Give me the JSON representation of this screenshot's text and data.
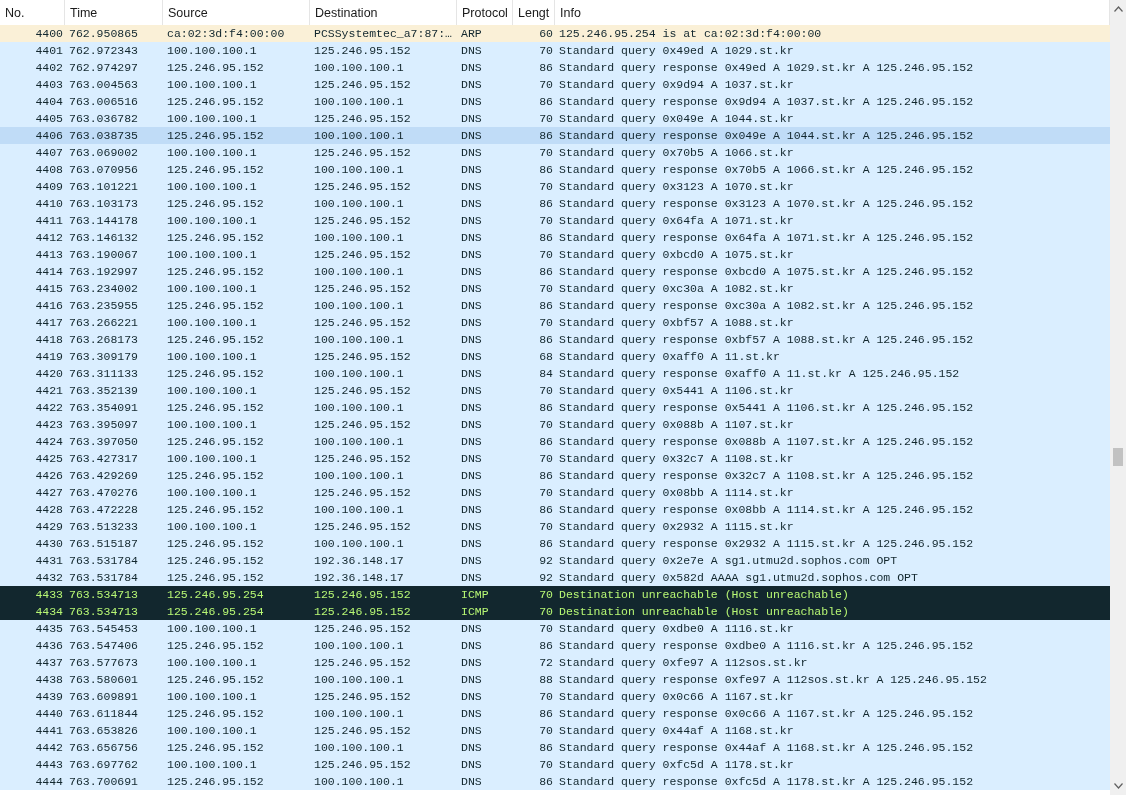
{
  "table": {
    "columns": [
      "No.",
      "Time",
      "Source",
      "Destination",
      "Protocol",
      "Lengt",
      "Info"
    ],
    "rows": [
      {
        "kind": "arp",
        "selected": false,
        "cells": [
          "4400",
          "762.950865",
          "ca:02:3d:f4:00:00",
          "PCSSystemtec_a7:87:…",
          "ARP",
          "60",
          "125.246.95.254 is at ca:02:3d:f4:00:00"
        ]
      },
      {
        "kind": "dns",
        "selected": false,
        "cells": [
          "4401",
          "762.972343",
          "100.100.100.1",
          "125.246.95.152",
          "DNS",
          "70",
          "Standard query 0x49ed A 1029.st.kr"
        ]
      },
      {
        "kind": "dns",
        "selected": false,
        "cells": [
          "4402",
          "762.974297",
          "125.246.95.152",
          "100.100.100.1",
          "DNS",
          "86",
          "Standard query response 0x49ed A 1029.st.kr A 125.246.95.152"
        ]
      },
      {
        "kind": "dns",
        "selected": false,
        "cells": [
          "4403",
          "763.004563",
          "100.100.100.1",
          "125.246.95.152",
          "DNS",
          "70",
          "Standard query 0x9d94 A 1037.st.kr"
        ]
      },
      {
        "kind": "dns",
        "selected": false,
        "cells": [
          "4404",
          "763.006516",
          "125.246.95.152",
          "100.100.100.1",
          "DNS",
          "86",
          "Standard query response 0x9d94 A 1037.st.kr A 125.246.95.152"
        ]
      },
      {
        "kind": "dns",
        "selected": false,
        "cells": [
          "4405",
          "763.036782",
          "100.100.100.1",
          "125.246.95.152",
          "DNS",
          "70",
          "Standard query 0x049e A 1044.st.kr"
        ]
      },
      {
        "kind": "dns",
        "selected": true,
        "cells": [
          "4406",
          "763.038735",
          "125.246.95.152",
          "100.100.100.1",
          "DNS",
          "86",
          "Standard query response 0x049e A 1044.st.kr A 125.246.95.152"
        ]
      },
      {
        "kind": "dns",
        "selected": false,
        "cells": [
          "4407",
          "763.069002",
          "100.100.100.1",
          "125.246.95.152",
          "DNS",
          "70",
          "Standard query 0x70b5 A 1066.st.kr"
        ]
      },
      {
        "kind": "dns",
        "selected": false,
        "cells": [
          "4408",
          "763.070956",
          "125.246.95.152",
          "100.100.100.1",
          "DNS",
          "86",
          "Standard query response 0x70b5 A 1066.st.kr A 125.246.95.152"
        ]
      },
      {
        "kind": "dns",
        "selected": false,
        "cells": [
          "4409",
          "763.101221",
          "100.100.100.1",
          "125.246.95.152",
          "DNS",
          "70",
          "Standard query 0x3123 A 1070.st.kr"
        ]
      },
      {
        "kind": "dns",
        "selected": false,
        "cells": [
          "4410",
          "763.103173",
          "125.246.95.152",
          "100.100.100.1",
          "DNS",
          "86",
          "Standard query response 0x3123 A 1070.st.kr A 125.246.95.152"
        ]
      },
      {
        "kind": "dns",
        "selected": false,
        "cells": [
          "4411",
          "763.144178",
          "100.100.100.1",
          "125.246.95.152",
          "DNS",
          "70",
          "Standard query 0x64fa A 1071.st.kr"
        ]
      },
      {
        "kind": "dns",
        "selected": false,
        "cells": [
          "4412",
          "763.146132",
          "125.246.95.152",
          "100.100.100.1",
          "DNS",
          "86",
          "Standard query response 0x64fa A 1071.st.kr A 125.246.95.152"
        ]
      },
      {
        "kind": "dns",
        "selected": false,
        "cells": [
          "4413",
          "763.190067",
          "100.100.100.1",
          "125.246.95.152",
          "DNS",
          "70",
          "Standard query 0xbcd0 A 1075.st.kr"
        ]
      },
      {
        "kind": "dns",
        "selected": false,
        "cells": [
          "4414",
          "763.192997",
          "125.246.95.152",
          "100.100.100.1",
          "DNS",
          "86",
          "Standard query response 0xbcd0 A 1075.st.kr A 125.246.95.152"
        ]
      },
      {
        "kind": "dns",
        "selected": false,
        "cells": [
          "4415",
          "763.234002",
          "100.100.100.1",
          "125.246.95.152",
          "DNS",
          "70",
          "Standard query 0xc30a A 1082.st.kr"
        ]
      },
      {
        "kind": "dns",
        "selected": false,
        "cells": [
          "4416",
          "763.235955",
          "125.246.95.152",
          "100.100.100.1",
          "DNS",
          "86",
          "Standard query response 0xc30a A 1082.st.kr A 125.246.95.152"
        ]
      },
      {
        "kind": "dns",
        "selected": false,
        "cells": [
          "4417",
          "763.266221",
          "100.100.100.1",
          "125.246.95.152",
          "DNS",
          "70",
          "Standard query 0xbf57 A 1088.st.kr"
        ]
      },
      {
        "kind": "dns",
        "selected": false,
        "cells": [
          "4418",
          "763.268173",
          "125.246.95.152",
          "100.100.100.1",
          "DNS",
          "86",
          "Standard query response 0xbf57 A 1088.st.kr A 125.246.95.152"
        ]
      },
      {
        "kind": "dns",
        "selected": false,
        "cells": [
          "4419",
          "763.309179",
          "100.100.100.1",
          "125.246.95.152",
          "DNS",
          "68",
          "Standard query 0xaff0 A 11.st.kr"
        ]
      },
      {
        "kind": "dns",
        "selected": false,
        "cells": [
          "4420",
          "763.311133",
          "125.246.95.152",
          "100.100.100.1",
          "DNS",
          "84",
          "Standard query response 0xaff0 A 11.st.kr A 125.246.95.152"
        ]
      },
      {
        "kind": "dns",
        "selected": false,
        "cells": [
          "4421",
          "763.352139",
          "100.100.100.1",
          "125.246.95.152",
          "DNS",
          "70",
          "Standard query 0x5441 A 1106.st.kr"
        ]
      },
      {
        "kind": "dns",
        "selected": false,
        "cells": [
          "4422",
          "763.354091",
          "125.246.95.152",
          "100.100.100.1",
          "DNS",
          "86",
          "Standard query response 0x5441 A 1106.st.kr A 125.246.95.152"
        ]
      },
      {
        "kind": "dns",
        "selected": false,
        "cells": [
          "4423",
          "763.395097",
          "100.100.100.1",
          "125.246.95.152",
          "DNS",
          "70",
          "Standard query 0x088b A 1107.st.kr"
        ]
      },
      {
        "kind": "dns",
        "selected": false,
        "cells": [
          "4424",
          "763.397050",
          "125.246.95.152",
          "100.100.100.1",
          "DNS",
          "86",
          "Standard query response 0x088b A 1107.st.kr A 125.246.95.152"
        ]
      },
      {
        "kind": "dns",
        "selected": false,
        "cells": [
          "4425",
          "763.427317",
          "100.100.100.1",
          "125.246.95.152",
          "DNS",
          "70",
          "Standard query 0x32c7 A 1108.st.kr"
        ]
      },
      {
        "kind": "dns",
        "selected": false,
        "cells": [
          "4426",
          "763.429269",
          "125.246.95.152",
          "100.100.100.1",
          "DNS",
          "86",
          "Standard query response 0x32c7 A 1108.st.kr A 125.246.95.152"
        ]
      },
      {
        "kind": "dns",
        "selected": false,
        "cells": [
          "4427",
          "763.470276",
          "100.100.100.1",
          "125.246.95.152",
          "DNS",
          "70",
          "Standard query 0x08bb A 1114.st.kr"
        ]
      },
      {
        "kind": "dns",
        "selected": false,
        "cells": [
          "4428",
          "763.472228",
          "125.246.95.152",
          "100.100.100.1",
          "DNS",
          "86",
          "Standard query response 0x08bb A 1114.st.kr A 125.246.95.152"
        ]
      },
      {
        "kind": "dns",
        "selected": false,
        "cells": [
          "4429",
          "763.513233",
          "100.100.100.1",
          "125.246.95.152",
          "DNS",
          "70",
          "Standard query 0x2932 A 1115.st.kr"
        ]
      },
      {
        "kind": "dns",
        "selected": false,
        "cells": [
          "4430",
          "763.515187",
          "125.246.95.152",
          "100.100.100.1",
          "DNS",
          "86",
          "Standard query response 0x2932 A 1115.st.kr A 125.246.95.152"
        ]
      },
      {
        "kind": "dns",
        "selected": false,
        "cells": [
          "4431",
          "763.531784",
          "125.246.95.152",
          "192.36.148.17",
          "DNS",
          "92",
          "Standard query 0x2e7e A sg1.utmu2d.sophos.com OPT"
        ]
      },
      {
        "kind": "dns",
        "selected": false,
        "cells": [
          "4432",
          "763.531784",
          "125.246.95.152",
          "192.36.148.17",
          "DNS",
          "92",
          "Standard query 0x582d AAAA sg1.utmu2d.sophos.com OPT"
        ]
      },
      {
        "kind": "icmp",
        "selected": false,
        "cells": [
          "4433",
          "763.534713",
          "125.246.95.254",
          "125.246.95.152",
          "ICMP",
          "70",
          "Destination unreachable (Host unreachable)"
        ]
      },
      {
        "kind": "icmp",
        "selected": false,
        "cells": [
          "4434",
          "763.534713",
          "125.246.95.254",
          "125.246.95.152",
          "ICMP",
          "70",
          "Destination unreachable (Host unreachable)"
        ]
      },
      {
        "kind": "dns",
        "selected": false,
        "cells": [
          "4435",
          "763.545453",
          "100.100.100.1",
          "125.246.95.152",
          "DNS",
          "70",
          "Standard query 0xdbe0 A 1116.st.kr"
        ]
      },
      {
        "kind": "dns",
        "selected": false,
        "cells": [
          "4436",
          "763.547406",
          "125.246.95.152",
          "100.100.100.1",
          "DNS",
          "86",
          "Standard query response 0xdbe0 A 1116.st.kr A 125.246.95.152"
        ]
      },
      {
        "kind": "dns",
        "selected": false,
        "cells": [
          "4437",
          "763.577673",
          "100.100.100.1",
          "125.246.95.152",
          "DNS",
          "72",
          "Standard query 0xfe97 A 112sos.st.kr"
        ]
      },
      {
        "kind": "dns",
        "selected": false,
        "cells": [
          "4438",
          "763.580601",
          "125.246.95.152",
          "100.100.100.1",
          "DNS",
          "88",
          "Standard query response 0xfe97 A 112sos.st.kr A 125.246.95.152"
        ]
      },
      {
        "kind": "dns",
        "selected": false,
        "cells": [
          "4439",
          "763.609891",
          "100.100.100.1",
          "125.246.95.152",
          "DNS",
          "70",
          "Standard query 0x0c66 A 1167.st.kr"
        ]
      },
      {
        "kind": "dns",
        "selected": false,
        "cells": [
          "4440",
          "763.611844",
          "125.246.95.152",
          "100.100.100.1",
          "DNS",
          "86",
          "Standard query response 0x0c66 A 1167.st.kr A 125.246.95.152"
        ]
      },
      {
        "kind": "dns",
        "selected": false,
        "cells": [
          "4441",
          "763.653826",
          "100.100.100.1",
          "125.246.95.152",
          "DNS",
          "70",
          "Standard query 0x44af A 1168.st.kr"
        ]
      },
      {
        "kind": "dns",
        "selected": false,
        "cells": [
          "4442",
          "763.656756",
          "125.246.95.152",
          "100.100.100.1",
          "DNS",
          "86",
          "Standard query response 0x44af A 1168.st.kr A 125.246.95.152"
        ]
      },
      {
        "kind": "dns",
        "selected": false,
        "cells": [
          "4443",
          "763.697762",
          "100.100.100.1",
          "125.246.95.152",
          "DNS",
          "70",
          "Standard query 0xfc5d A 1178.st.kr"
        ]
      },
      {
        "kind": "dns",
        "selected": false,
        "cells": [
          "4444",
          "763.700691",
          "125.246.95.152",
          "100.100.100.1",
          "DNS",
          "86",
          "Standard query response 0xfc5d A 1178.st.kr A 125.246.95.152"
        ]
      }
    ]
  }
}
